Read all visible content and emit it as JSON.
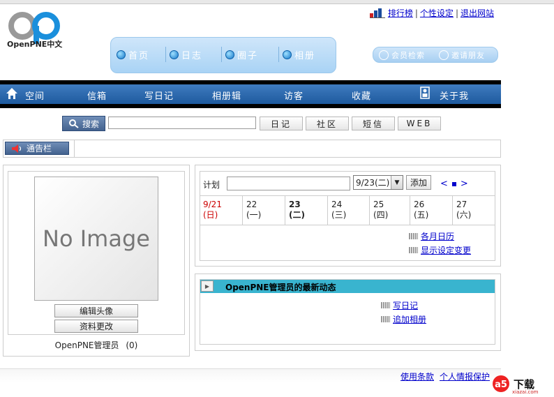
{
  "header": {
    "logo_text": "OpenPNE中文",
    "top_links": [
      "排行榜",
      "个性设定",
      "退出网站"
    ]
  },
  "main_nav": [
    "首页",
    "日志",
    "圈子",
    "相册"
  ],
  "member_bar": [
    "会员检索",
    "邀请朋友"
  ],
  "menu_bar": [
    "空间",
    "信箱",
    "写日记",
    "相册辑",
    "访客",
    "收藏",
    "关于我"
  ],
  "search": {
    "button": "搜索",
    "value": "",
    "buttons": [
      "日记",
      "社区",
      "短信",
      "WEB"
    ]
  },
  "notice": {
    "label": "通告栏"
  },
  "profile": {
    "image_text": "No Image",
    "edit_photo": "编辑头像",
    "edit_profile": "资料更改",
    "name": "OpenPNE管理员",
    "count": "(0)"
  },
  "calendar": {
    "plan_label": "计划",
    "plan_value": "",
    "date_value": "9/23(二)",
    "add_button": "添加",
    "prev": "<",
    "next": ">",
    "days": [
      {
        "date": "9/21",
        "weekday": "(日)"
      },
      {
        "date": "22",
        "weekday": "(一)"
      },
      {
        "date": "23",
        "weekday": "(二)"
      },
      {
        "date": "24",
        "weekday": "(三)"
      },
      {
        "date": "25",
        "weekday": "(四)"
      },
      {
        "date": "26",
        "weekday": "(五)"
      },
      {
        "date": "27",
        "weekday": "(六)"
      }
    ],
    "links": [
      "各月日历",
      "显示设定变更"
    ]
  },
  "news": {
    "title": "OpenPNE管理员的最新动态",
    "links": [
      "写日记",
      "追加相册"
    ]
  },
  "footer": {
    "links": [
      "使用条款",
      "个人情报保护"
    ]
  },
  "watermark": {
    "text": "下载",
    "sub": "xiazai.com",
    "brand": "a5"
  },
  "colors": {
    "accent": "#39b4cf",
    "menu": "#2a67ad",
    "nav_light": "#a9d3f5"
  }
}
